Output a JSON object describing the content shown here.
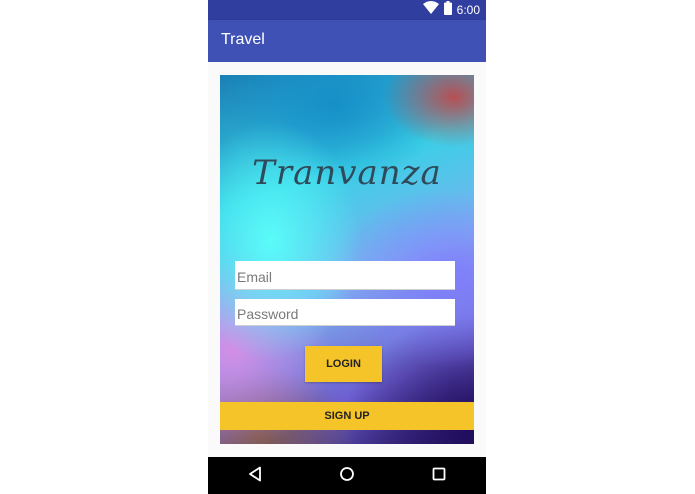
{
  "status_bar": {
    "time": "6:00",
    "icons": [
      "wifi-icon",
      "battery-icon"
    ]
  },
  "app_bar": {
    "title": "Travel",
    "color": "#3f51b5"
  },
  "login": {
    "brand": "Tranvanza",
    "email_placeholder": "Email",
    "email_value": "",
    "password_placeholder": "Password",
    "password_value": "",
    "login_label": "LOGIN",
    "signup_label": "SIGN UP",
    "accent_color": "#f4c428"
  },
  "nav_bar": {
    "icons": [
      "back-icon",
      "home-icon",
      "recents-icon"
    ]
  }
}
